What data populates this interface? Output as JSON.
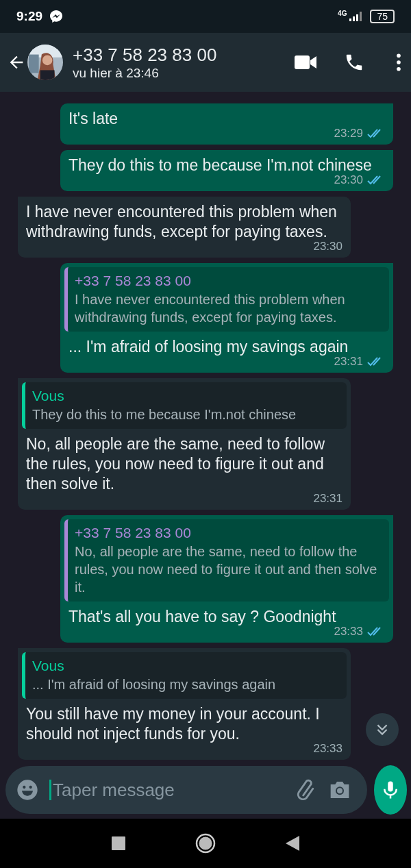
{
  "status_bar": {
    "time": "9:29",
    "network": "4G",
    "battery": "75"
  },
  "header": {
    "name": "+33 7 58 23 83 00",
    "last_seen": "vu hier à 23:46"
  },
  "messages": [
    {
      "kind": "out",
      "text": "It's late",
      "time": "23:29",
      "read": true
    },
    {
      "kind": "out",
      "text": "They do this to me because I'm.not chinese",
      "time": "23:30",
      "read": true
    },
    {
      "kind": "in",
      "text": "I have never encountered this problem when withdrawing funds, except for paying taxes.",
      "time": "23:30"
    },
    {
      "kind": "out",
      "quote": {
        "author": "+33 7 58 23 83 00",
        "color": "#a987d6",
        "text": "I have never encountered this problem when withdrawing funds, except for paying taxes."
      },
      "text": "... I'm afraid of loosing my savings again",
      "time": "23:31",
      "read": true
    },
    {
      "kind": "in",
      "quote": {
        "author": "Vous",
        "color": "#06cf9c",
        "text": "They do this to me because I'm.not chinese"
      },
      "text": "No, all people are the same, need to follow the rules, you now need to figure it out and then solve it.",
      "time": "23:31"
    },
    {
      "kind": "out",
      "quote": {
        "author": "+33 7 58 23 83 00",
        "color": "#a987d6",
        "text": "No, all people are the same, need to follow the rules, you now need to figure it out and then solve it."
      },
      "text": "That's all you have to say ? Goodnight",
      "time": "23:33",
      "read": true
    },
    {
      "kind": "in",
      "quote": {
        "author": "Vous",
        "color": "#06cf9c",
        "text": "... I'm afraid of loosing my savings again"
      },
      "text": "You still have my money in your account. I should not inject funds for you.",
      "time": "23:33"
    }
  ],
  "composer": {
    "placeholder": "Taper message"
  }
}
